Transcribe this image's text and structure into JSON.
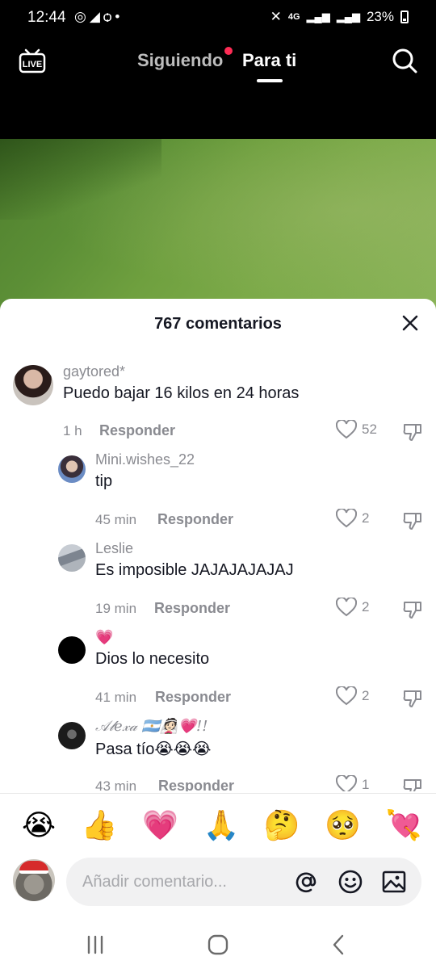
{
  "status_bar": {
    "time": "12:44",
    "notification_icons": [
      "whatsapp-icon",
      "telegram-icon",
      "tiktok-icon",
      "dot"
    ],
    "battery": "23%",
    "network": "4G"
  },
  "top_nav": {
    "tabs": [
      {
        "label": "Siguiendo",
        "active": false,
        "has_dot": true
      },
      {
        "label": "Para ti",
        "active": true
      }
    ],
    "live_label": "LIVE"
  },
  "comments_sheet": {
    "title": "767 comentarios",
    "reply_label": "Responder",
    "comments": [
      {
        "username": "gaytored*",
        "text": "Puedo bajar 16 kilos en 24 horas",
        "time": "1 h",
        "likes": "52",
        "level": "top"
      },
      {
        "username": "Mini.wishes_22",
        "text": "tip",
        "time": "45 min",
        "likes": "2",
        "level": "reply"
      },
      {
        "username": "Leslie",
        "text": "Es imposible JAJAJAJAJAJ",
        "time": "19 min",
        "likes": "2",
        "level": "reply"
      },
      {
        "username": "💗",
        "text": "Dios lo necesito",
        "time": "41 min",
        "likes": "2",
        "level": "reply"
      },
      {
        "username": "𝒜𝓁𝑒𝓍𝒶 🇦🇷👰🏻💗!! ",
        "text": "Pasa tío😭😭😭",
        "time": "43 min",
        "likes": "1",
        "level": "reply"
      }
    ]
  },
  "emoji_bar": [
    "😭",
    "👍",
    "💗",
    "🙏",
    "🤔",
    "🥺",
    "💘"
  ],
  "comment_input": {
    "placeholder": "Añadir comentario..."
  },
  "colors": {
    "accent_red": "#fe2c55",
    "text_primary": "#161823",
    "text_secondary": "#8a8b91"
  }
}
